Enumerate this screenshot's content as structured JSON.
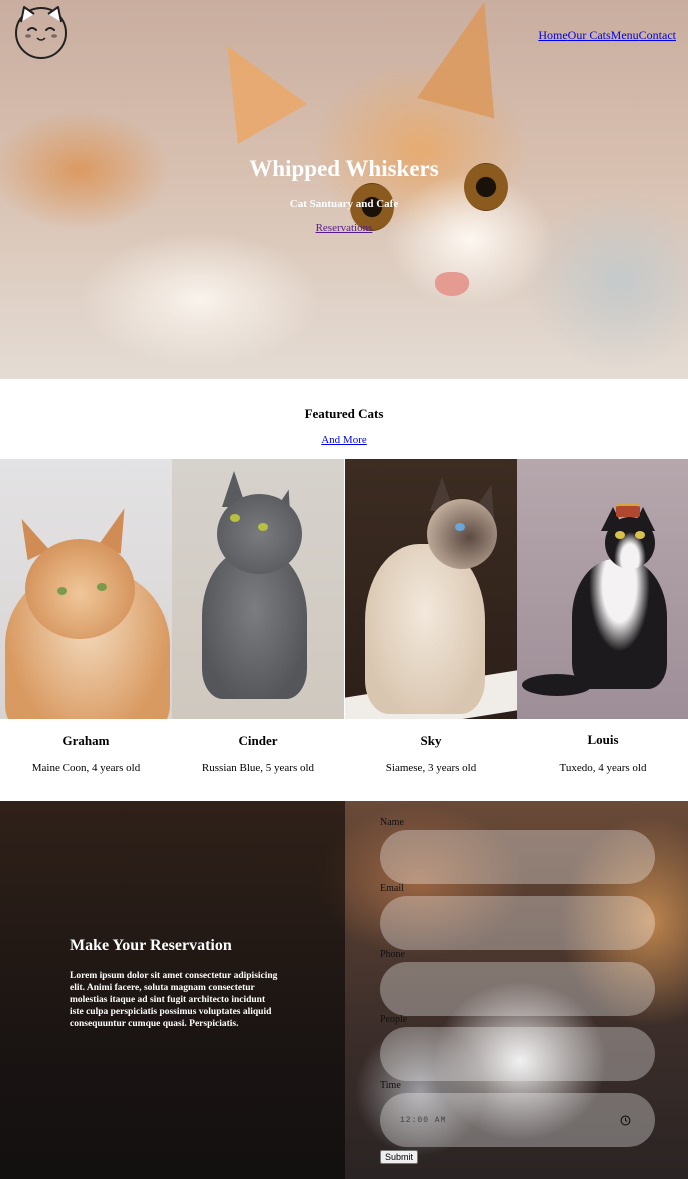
{
  "nav": {
    "items": [
      "Home",
      "Our Cats",
      "Menu",
      "Contact"
    ]
  },
  "hero": {
    "title": "Whipped Whiskers",
    "subtitle": "Cat Santuary and Cafe",
    "link": "Reservations"
  },
  "featured": {
    "title": "Featured Cats",
    "more_link": "And More",
    "cats": [
      {
        "name": "Graham",
        "description": "Maine Coon, 4 years old"
      },
      {
        "name": "Cinder",
        "description": "Russian Blue, 5 years old"
      },
      {
        "name": "Sky",
        "description": "Siamese, 3 years old"
      },
      {
        "name": "Louis",
        "description": "Tuxedo, 4 years old"
      }
    ]
  },
  "reservation": {
    "title": "Make Your Reservation",
    "text": "Lorem ipsum dolor sit amet consectetur adipisicing elit. Animi facere, soluta magnam consectetur molestias itaque ad sint fugit architecto incidunt iste culpa perspiciatis possimus voluptates aliquid consequuntur cumque quasi. Perspiciatis.",
    "form": {
      "name_label": "Name",
      "email_label": "Email",
      "phone_label": "Phone",
      "people_label": "People",
      "time_label": "Time",
      "time_value": "12:00 AM",
      "submit_label": "Submit"
    }
  },
  "colors": {
    "link": "#0000ee",
    "visited_link": "#551a8b",
    "hero_text": "#ffffff"
  }
}
